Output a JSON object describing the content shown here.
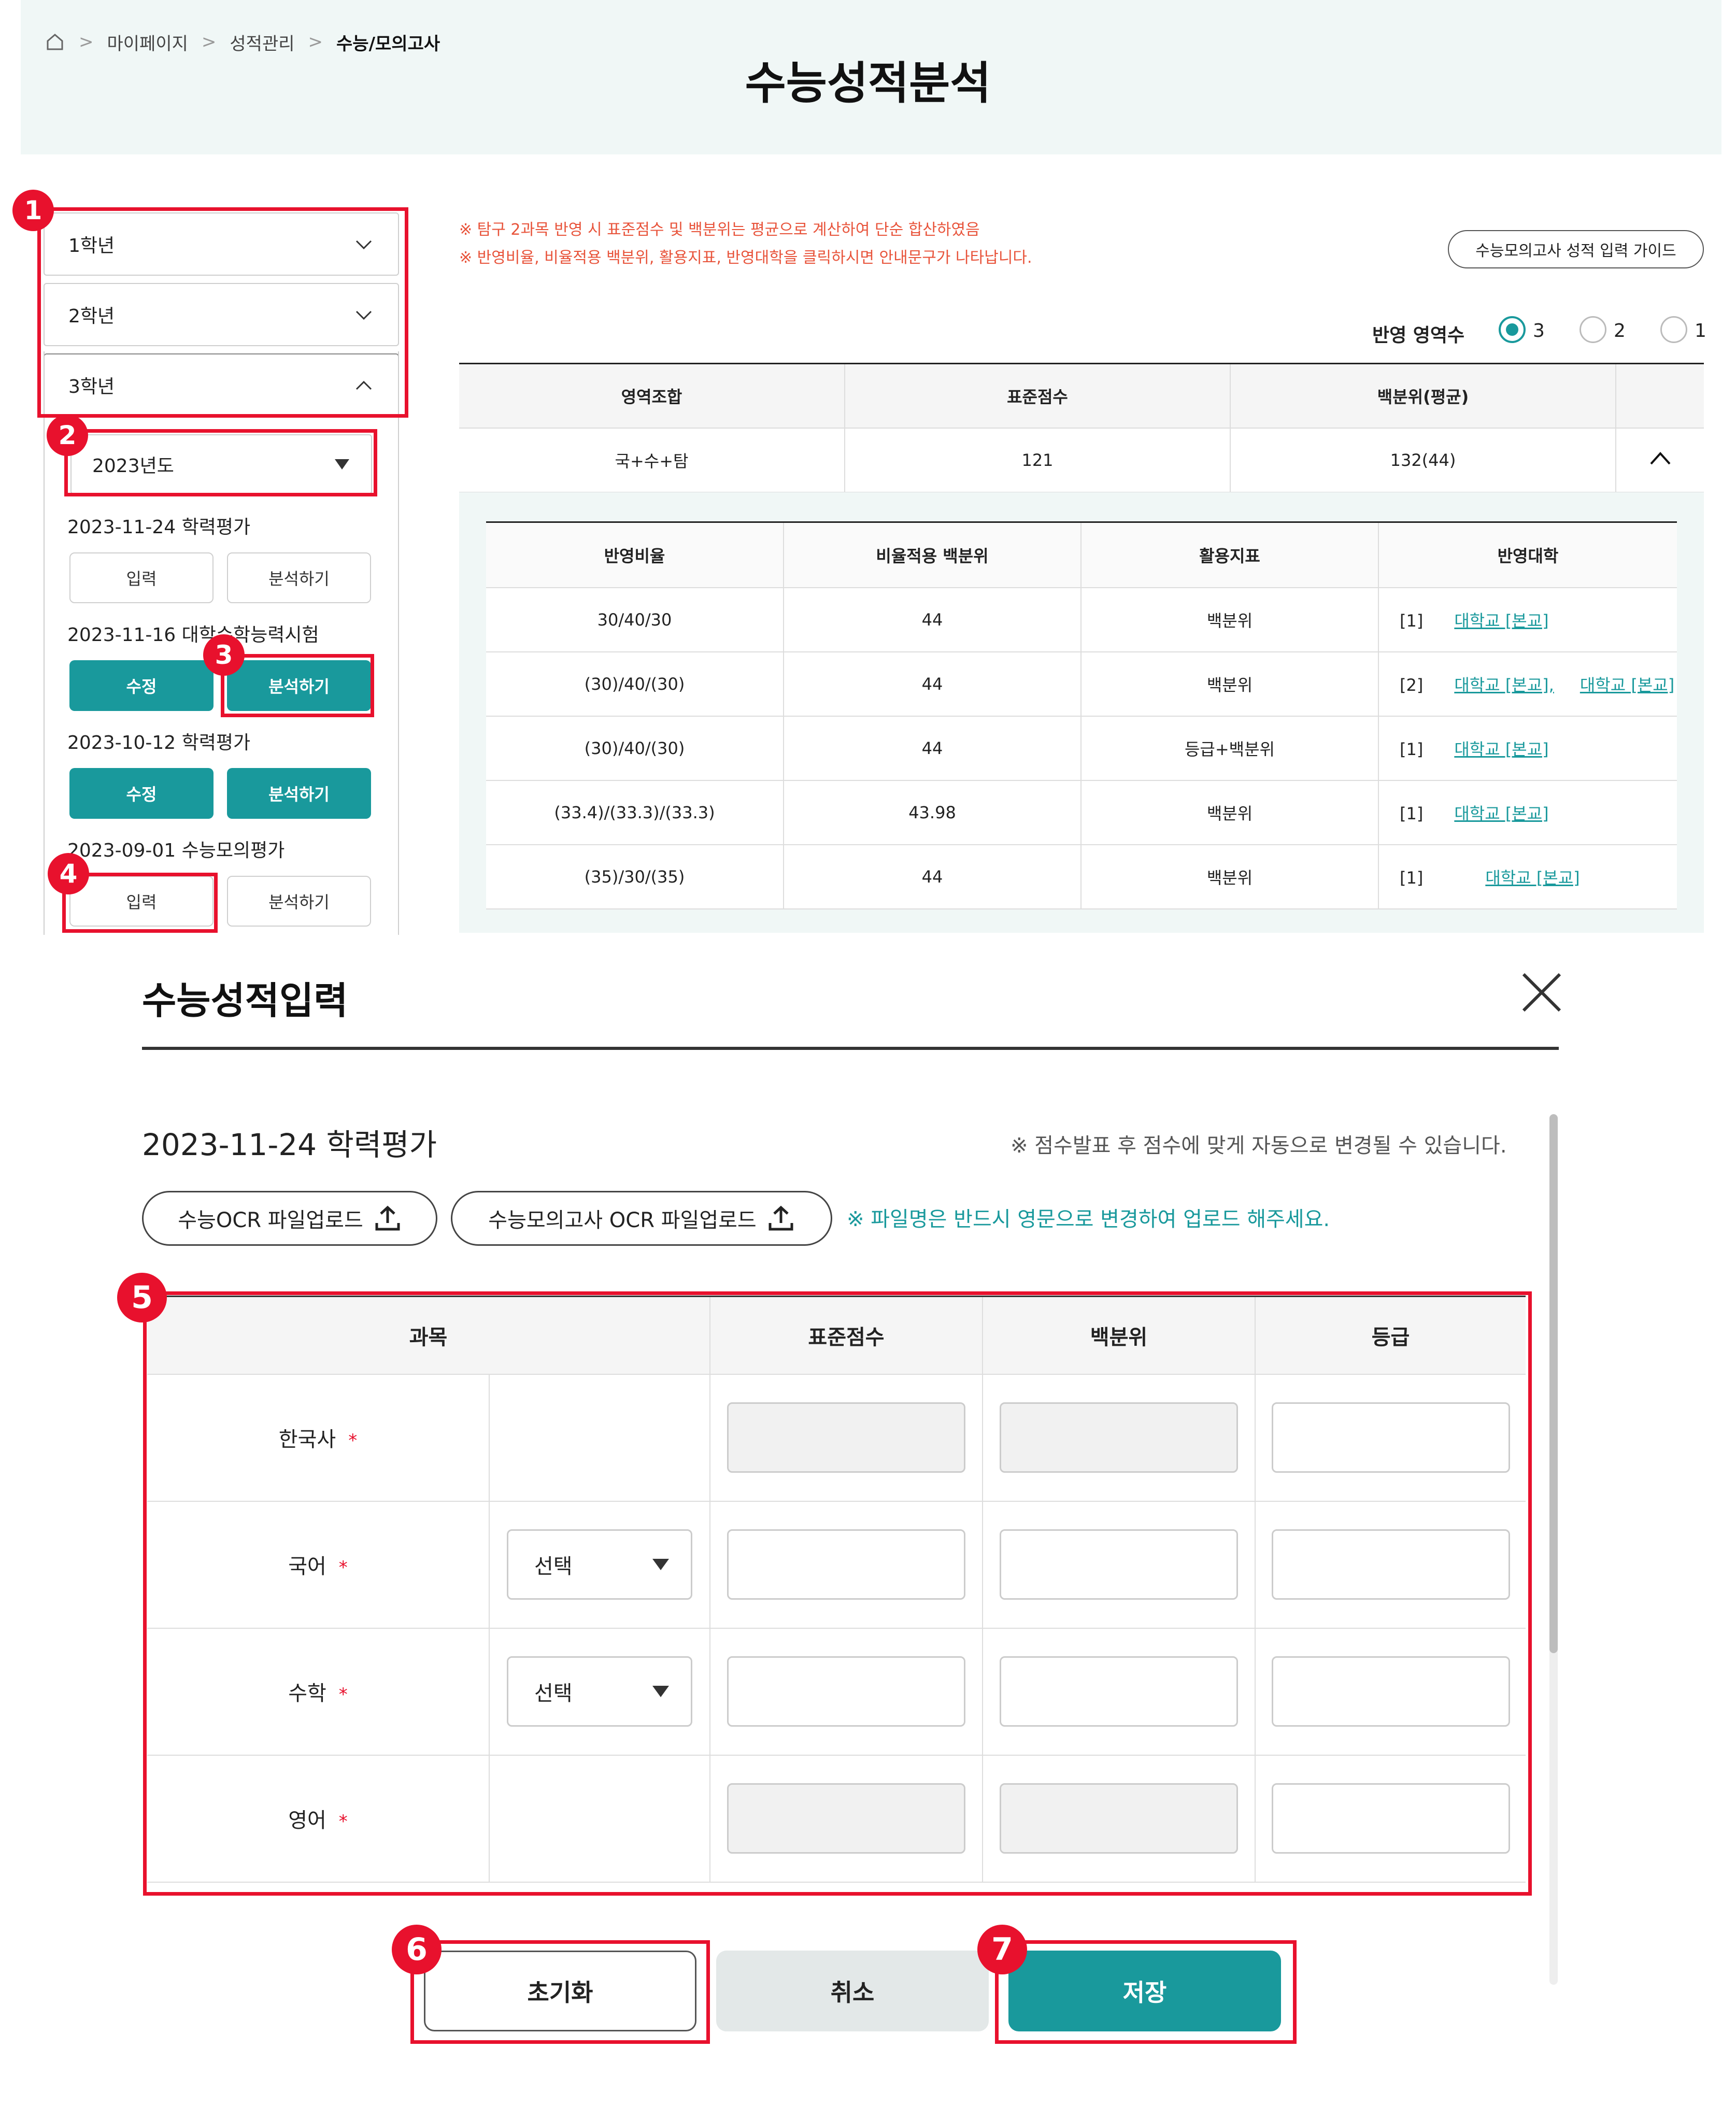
{
  "breadcrumb": {
    "home": "home-icon",
    "items": [
      "마이페이지",
      "성적관리",
      "수능/모의고사"
    ],
    "separator": ">"
  },
  "page_title": "수능성적분석",
  "accordion": [
    {
      "label": "1학년",
      "state": "collapsed"
    },
    {
      "label": "2학년",
      "state": "collapsed"
    },
    {
      "label": "3학년",
      "state": "expanded"
    }
  ],
  "year_select": {
    "value": "2023년도"
  },
  "exams": [
    {
      "title": "2023-11-24 학력평가",
      "b1": "입력",
      "b2": "분석하기"
    },
    {
      "title": "2023-11-16 대학수학능력시험",
      "b1": "수정",
      "b2": "분석하기"
    },
    {
      "title": "2023-10-12 학력평가",
      "b1": "수정",
      "b2": "분석하기"
    },
    {
      "title": "2023-09-01 수능모의평가",
      "b1": "입력",
      "b2": "분석하기"
    }
  ],
  "notes": [
    "※ 탐구 2과목 반영 시 표준점수 및 백분위는 평균으로 계산하여 단순 합산하였음",
    "※ 반영비율, 비율적용 백분위, 활용지표, 반영대학을 클릭하시면 안내문구가 나타납니다."
  ],
  "guide_button": "수능모의고사 성적 입력 가이드",
  "radio": {
    "label": "반영 영역수",
    "options": [
      "3",
      "2",
      "1"
    ],
    "selected": "3"
  },
  "summary": {
    "headers": [
      "영역조합",
      "표준점수",
      "백분위(평균)"
    ],
    "row": [
      "국+수+탐",
      "121",
      "132(44)"
    ]
  },
  "detail": {
    "headers": [
      "반영비율",
      "비율적용 백분위",
      "활용지표",
      "반영대학"
    ],
    "rows": [
      {
        "ratio": "30/40/30",
        "pct": "44",
        "idx": "백분위",
        "cnt": "[1]",
        "univ": "대학교 [본교]",
        "univ2": ""
      },
      {
        "ratio": "(30)/40/(30)",
        "pct": "44",
        "idx": "백분위",
        "cnt": "[2]",
        "univ": "대학교 [본교],",
        "univ2": "대학교 [본교]"
      },
      {
        "ratio": "(30)/40/(30)",
        "pct": "44",
        "idx": "등급+백분위",
        "cnt": "[1]",
        "univ": "대학교 [본교]",
        "univ2": ""
      },
      {
        "ratio": "(33.4)/(33.3)/(33.3)",
        "pct": "43.98",
        "idx": "백분위",
        "cnt": "[1]",
        "univ": "대학교 [본교]",
        "univ2": ""
      },
      {
        "ratio": "(35)/30/(35)",
        "pct": "44",
        "idx": "백분위",
        "cnt": "[1]",
        "univ": "대학교 [본교]",
        "univ2": ""
      }
    ]
  },
  "badges": [
    "1",
    "2",
    "3",
    "4",
    "5",
    "6",
    "7"
  ],
  "modal": {
    "title": "수능성적입력",
    "exam": "2023-11-24 학력평가",
    "note": "※ 점수발표 후 점수에 맞게 자동으로 변경될 수 있습니다.",
    "upload1": "수능OCR 파일업로드",
    "upload2": "수능모의고사 OCR 파일업로드",
    "upload_icon": "upload-icon",
    "upload_note": "※ 파일명은 반드시 영문으로 변경하여 업로드 해주세요.",
    "headers": [
      "과목",
      "표준점수",
      "백분위",
      "등급"
    ],
    "subjects": [
      {
        "name": "한국사",
        "select": ""
      },
      {
        "name": "국어",
        "select": "선택"
      },
      {
        "name": "수학",
        "select": "선택"
      },
      {
        "name": "영어",
        "select": ""
      }
    ],
    "required_mark": "*",
    "buttons": {
      "reset": "초기화",
      "cancel": "취소",
      "save": "저장"
    }
  },
  "colors": {
    "accent": "#19999c",
    "highlight": "#e8112d",
    "note": "#e8533a"
  }
}
